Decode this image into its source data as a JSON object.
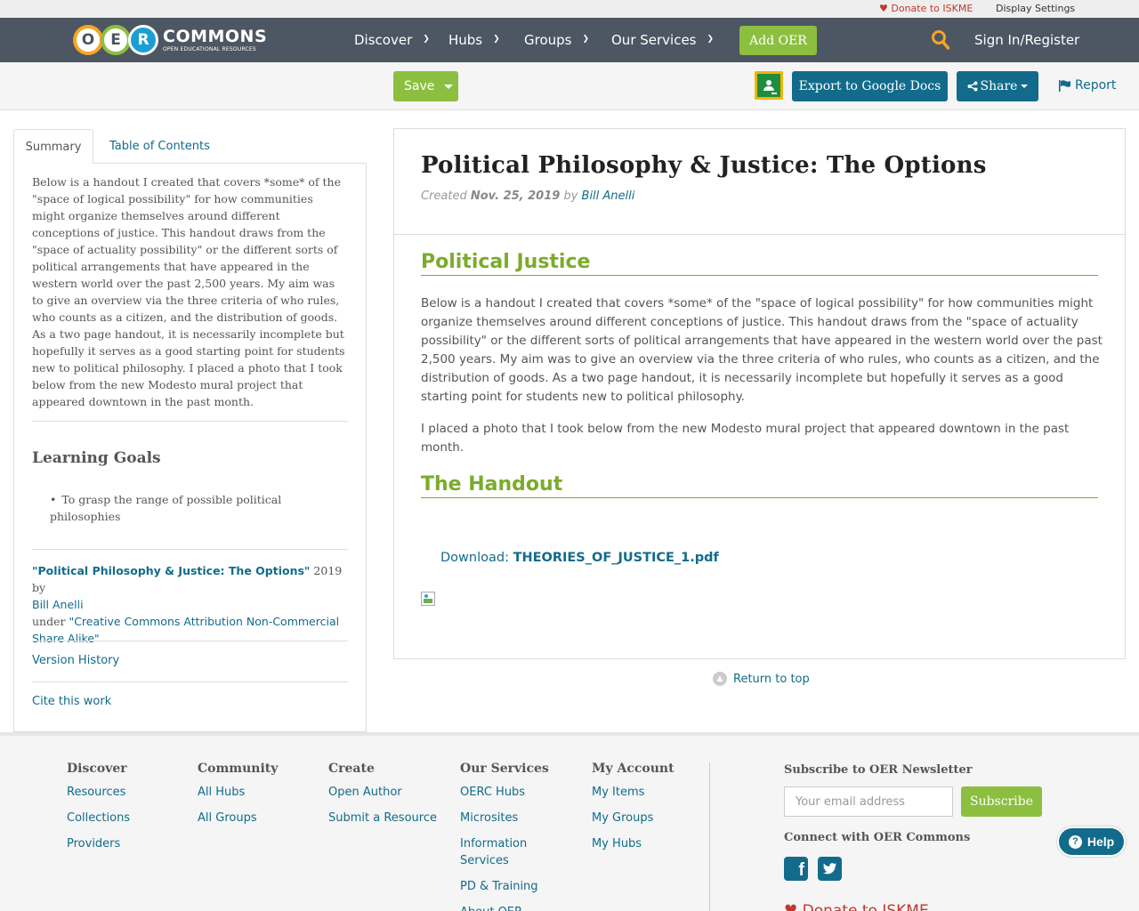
{
  "util_bar": {
    "donate": "Donate to ISKME",
    "display_settings": "Display Settings"
  },
  "header": {
    "logo_letters": [
      "O",
      "E",
      "R"
    ],
    "logo_title": "COMMONS",
    "logo_subtitle": "OPEN EDUCATIONAL RESOURCES",
    "nav": [
      "Discover",
      "Hubs",
      "Groups",
      "Our Services"
    ],
    "add_oer": "Add OER",
    "sign_in": "Sign In/Register"
  },
  "action_bar": {
    "save": "Save",
    "export": "Export to Google Docs",
    "share": "Share",
    "report": "Report"
  },
  "sidebar": {
    "tabs": [
      "Summary",
      "Table of Contents"
    ],
    "summary": "Below is a handout I created that covers *some* of the \"space of logical possibility\" for how communities might organize themselves around different conceptions of justice. This handout draws from the \"space of actuality possibility\" or the different sorts of political arrangements that have appeared in the western world over the past 2,500 years. My aim was to give an overview via the three criteria of who rules, who counts as a citizen, and the distribution of goods. As a two page handout, it is necessarily incomplete but hopefully it serves as a good starting point for students new to political philosophy. I placed a photo that I took below from the new Modesto mural project that appeared downtown in the past month.",
    "goals_title": "Learning Goals",
    "goals": [
      "To grasp the range of possible political philosophies"
    ],
    "attribution": {
      "title": "\"Political Philosophy & Justice: The Options\"",
      "year_by": " 2019 by",
      "author": "Bill Anelli",
      "under": "under ",
      "license": "\"Creative Commons Attribution Non-Commercial Share Alike\""
    },
    "version_history": "Version History",
    "cite": "Cite this work"
  },
  "article": {
    "title": "Political Philosophy & Justice: The Options",
    "created_label": "Created ",
    "date": "Nov. 25, 2019",
    "by": " by ",
    "author": "Bill Anelli",
    "section1_title": "Political Justice",
    "section1_p1": "Below is a handout I created that covers *some* of the \"space of logical possibility\" for how communities might organize themselves around different conceptions of justice. This handout draws from the \"space of actuality possibility\" or the different sorts of political arrangements that have appeared in the western world over the past 2,500 years. My aim was to give an overview via the three criteria of who rules, who counts as a citizen, and the distribution of goods. As a two page handout, it is necessarily incomplete but hopefully it serves as a good starting point for students new to political philosophy.",
    "section1_p2": "I placed a photo that I took below from the new Modesto mural project that appeared downtown in the past month.",
    "section2_title": "The Handout",
    "download_label": "Download: ",
    "download_file": "THEORIES_OF_JUSTICE_1.pdf"
  },
  "return_top": "Return to top",
  "footer": {
    "columns": [
      {
        "title": "Discover",
        "links": [
          "Resources",
          "Collections",
          "Providers"
        ]
      },
      {
        "title": "Community",
        "links": [
          "All Hubs",
          "All Groups"
        ]
      },
      {
        "title": "Create",
        "links": [
          "Open Author",
          "Submit a Resource"
        ]
      },
      {
        "title": "Our Services",
        "links": [
          "OERC Hubs",
          "Microsites",
          "Information Services",
          "PD & Training",
          "About OER"
        ]
      },
      {
        "title": "My Account",
        "links": [
          "My Items",
          "My Groups",
          "My Hubs"
        ]
      }
    ],
    "newsletter_title": "Subscribe to OER Newsletter",
    "email_placeholder": "Your email address",
    "subscribe": "Subscribe",
    "connect_title": "Connect with OER Commons",
    "donate": "Donate to ISKME",
    "help": "Help"
  },
  "colors": {
    "header_bg": "#4d5663",
    "accent_green": "#8cbf3f",
    "link_teal": "#126b8b",
    "donate_red": "#c0392b"
  },
  "icons": [
    "heart-icon",
    "chevron-down-icon",
    "search-icon",
    "google-classroom-icon",
    "share-icon",
    "flag-icon",
    "chevron-up-icon",
    "facebook-icon",
    "twitter-icon",
    "help-icon"
  ]
}
